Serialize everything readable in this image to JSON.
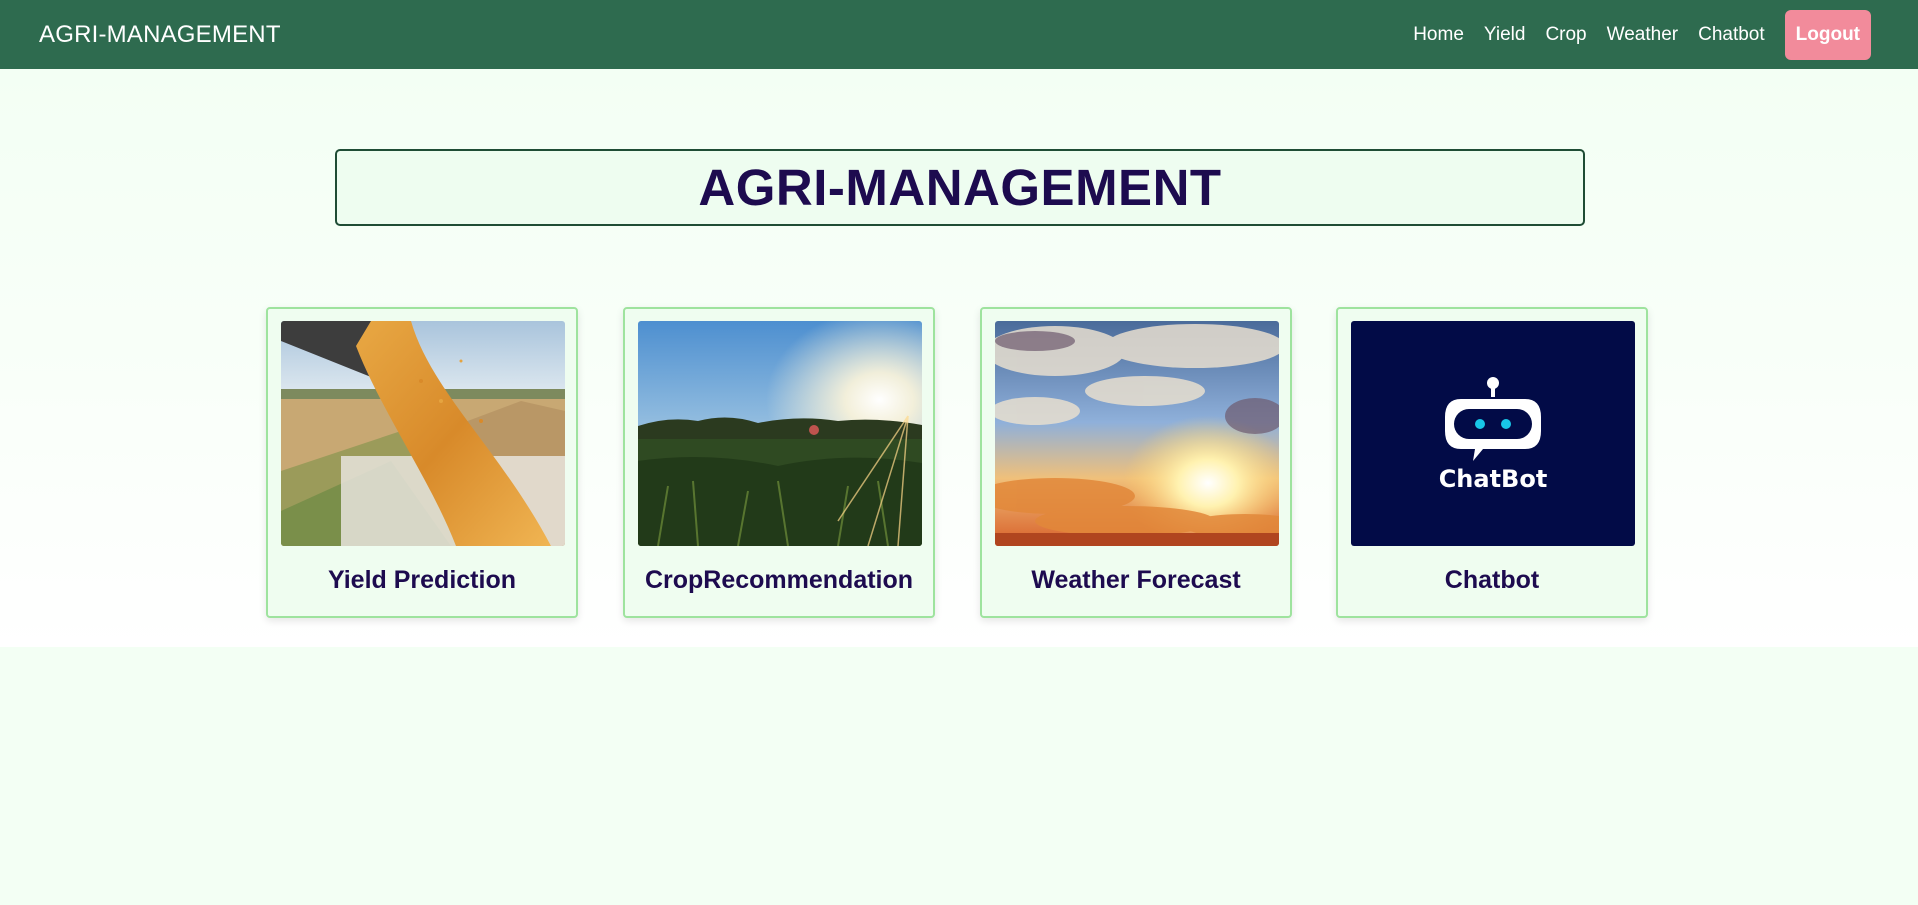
{
  "navbar": {
    "brand": "AGRI-MANAGEMENT",
    "links": [
      "Home",
      "Yield",
      "Crop",
      "Weather",
      "Chatbot"
    ],
    "logout_label": "Logout"
  },
  "hero": {
    "title": "AGRI-MANAGEMENT"
  },
  "cards": [
    {
      "title": "Yield Prediction"
    },
    {
      "title": "CropRecommendation"
    },
    {
      "title": "Weather Forecast"
    },
    {
      "title": "Chatbot",
      "image_text": "ChatBot"
    }
  ],
  "colors": {
    "navbar": "#2e6b4f",
    "logout": "#f28b9b",
    "heading": "#1d0b4f",
    "card_border": "#9ee39e",
    "page_background": "#f3fff4"
  }
}
